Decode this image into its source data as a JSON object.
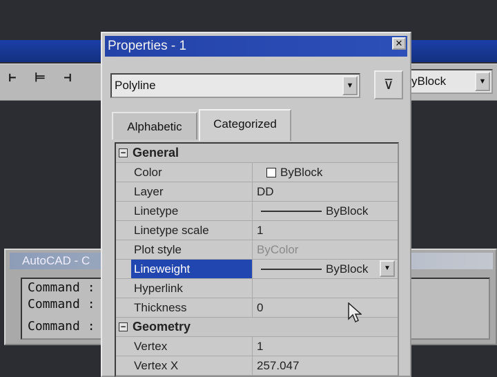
{
  "toolbar": {
    "icons": [
      "dim-linear-icon",
      "dim-aligned-icon",
      "dim-baseline-icon"
    ],
    "lineweight_combo_value": "yBlock"
  },
  "command_window": {
    "title": "AutoCAD - C",
    "lines": [
      "Command :",
      "Command :",
      "Command :"
    ]
  },
  "properties": {
    "title": "Properties - 1",
    "object_type": "Polyline",
    "tabs": [
      "Alphabetic",
      "Categorized"
    ],
    "active_tab": "Categorized",
    "categories": [
      {
        "name": "General",
        "expander": "−",
        "rows": [
          {
            "name": "Color",
            "value": "ByBlock",
            "kind": "color"
          },
          {
            "name": "Layer",
            "value": "DD",
            "kind": "text"
          },
          {
            "name": "Linetype",
            "value": "ByBlock",
            "kind": "line"
          },
          {
            "name": "Linetype scale",
            "value": "1",
            "kind": "text"
          },
          {
            "name": "Plot style",
            "value": "ByColor",
            "kind": "dim"
          },
          {
            "name": "Lineweight",
            "value": "ByBlock",
            "kind": "line-selected"
          },
          {
            "name": "Hyperlink",
            "value": "",
            "kind": "text"
          },
          {
            "name": "Thickness",
            "value": "0",
            "kind": "text"
          }
        ]
      },
      {
        "name": "Geometry",
        "expander": "−",
        "rows": [
          {
            "name": "Vertex",
            "value": "1",
            "kind": "text"
          },
          {
            "name": "Vertex X",
            "value": "257.047",
            "kind": "text"
          }
        ]
      }
    ]
  },
  "colors": {
    "title_bar": "#2443a9",
    "selection": "#2146b0",
    "panel": "#c8c8c8"
  }
}
